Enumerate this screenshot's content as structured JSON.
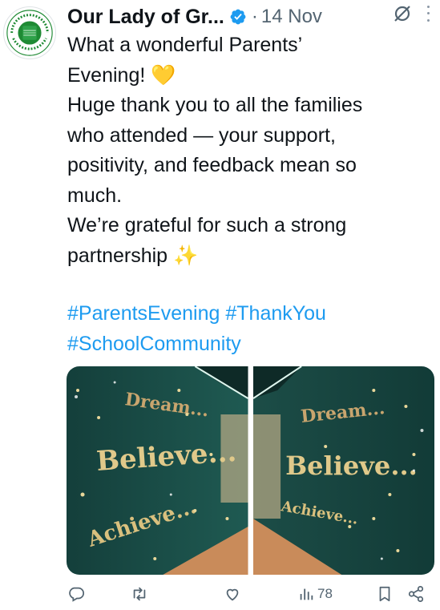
{
  "tweet": {
    "display_name": "Our Lady of Gr...",
    "separator": "·",
    "date": "14 Nov",
    "text_lines": [
      "What a wonderful Parents’\nEvening! 💛",
      "Huge thank you to all the families\nwho attended — your support,\npositivity, and feedback mean so\nmuch.",
      "We’re grateful for such a strong\npartnership ✨"
    ],
    "hashtags": [
      "#ParentsEvening",
      "#ThankYou",
      "#SchoolCommunity"
    ],
    "avatar": {
      "logo_text": "OUR LADY OF GRACE RC PRIMARY SCHOOL",
      "inner_text": "FAITH WORSHIP LEARNING"
    },
    "photos": {
      "left": {
        "words": [
          "Dream...",
          "Believe...",
          "Achieve..."
        ]
      },
      "right": {
        "words": [
          "Dream...",
          "Believe...",
          "Achieve..."
        ]
      }
    },
    "metrics": {
      "views": "78"
    }
  },
  "icons": {
    "verified": "verified-badge-icon",
    "grok": "grok-icon",
    "more": "more-options-icon",
    "reply": "reply-icon",
    "retweet": "retweet-icon",
    "like": "like-icon",
    "views": "views-icon",
    "bookmark": "bookmark-icon",
    "share": "share-icon"
  },
  "colors": {
    "link": "#1d9bf0",
    "verified": "#1d9bf0",
    "muted": "#536471",
    "text": "#0f1419",
    "school_green": "#1f8a34"
  }
}
